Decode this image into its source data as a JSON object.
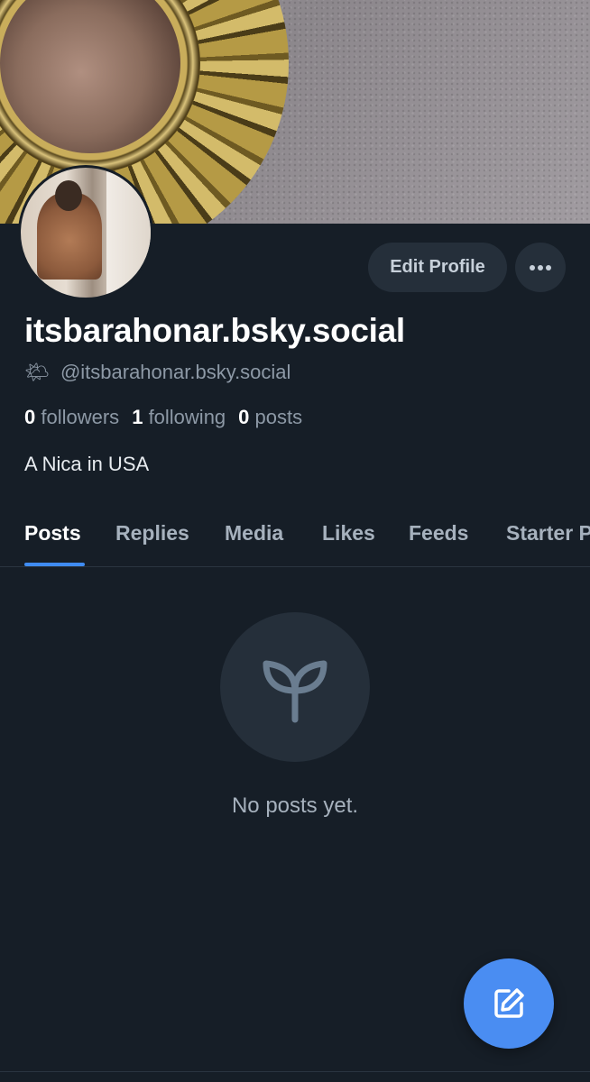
{
  "profile": {
    "display_name": "itsbarahonar.bsky.social",
    "handle": "@itsbarahonar.bsky.social",
    "handle_emoji": "🌤",
    "bio": "A Nica in USA",
    "stats": {
      "followers_count": "0",
      "followers_label": "followers",
      "following_count": "1",
      "following_label": "following",
      "posts_count": "0",
      "posts_label": "posts"
    }
  },
  "actions": {
    "edit_label": "Edit Profile",
    "more_icon": "ellipsis-icon"
  },
  "tabs": [
    {
      "label": "Posts",
      "active": true
    },
    {
      "label": "Replies",
      "active": false
    },
    {
      "label": "Media",
      "active": false
    },
    {
      "label": "Likes",
      "active": false
    },
    {
      "label": "Feeds",
      "active": false
    },
    {
      "label": "Starter Packs",
      "active": false
    }
  ],
  "empty_state": {
    "icon": "sprout-icon",
    "message": "No posts yet."
  },
  "fab": {
    "icon": "compose-icon"
  },
  "colors": {
    "background": "#161e27",
    "accent": "#3f8cf2",
    "fab": "#4a8df2",
    "muted_text": "#8d99a6"
  }
}
